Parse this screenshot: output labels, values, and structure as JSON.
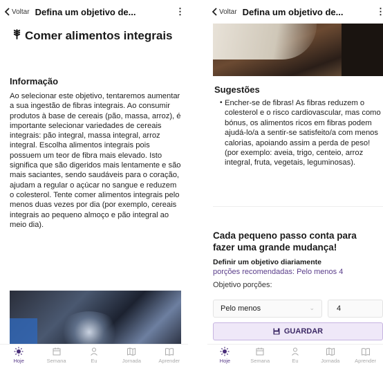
{
  "header": {
    "back_label": "Voltar",
    "title": "Defina um objetivo de...",
    "menu": "⋮"
  },
  "screen1": {
    "goal_title": "Comer alimentos integrais",
    "info_heading": "Informação",
    "info_text": "Ao selecionar este objetivo, tentaremos aumentar a sua ingestão de fibras integrais. Ao consumir produtos à base de cereais (pão, massa, arroz), é importante selecionar variedades de cereais integrais: pão integral, massa integral, arroz integral. Escolha alimentos integrais pois possuem um teor de fibra mais elevado. Isto significa que são digeridos mais lentamente e são mais saciantes, sendo saudáveis para o coração, ajudam a regular o açúcar no sangue e reduzem o colesterol. Tente comer alimentos integrais pelo menos duas vezes por dia (por exemplo, cereais integrais ao pequeno almoço e pão integral ao meio dia)."
  },
  "screen2": {
    "suggestions_heading": "Sugestões",
    "suggestion_text": "Encher-se de fibras! As fibras reduzem o colesterol e o risco cardiovascular, mas como bónus, os alimentos ricos em fibras podem ajudá-lo/a a sentir-se satisfeito/a com menos calorias, apoiando assim a perda de peso! (por exemplo: aveia, trigo, centeio, arroz integral, fruta, vegetais, leguminosas).",
    "cta": "Cada pequeno passo conta para fazer uma grande mudança!",
    "daily_goal_label": "Definir um objetivo diariamente",
    "recommended": "porções recomendadas: Pelo menos 4",
    "goal_portions_label": "Objetivo porções:",
    "select_value": "Pelo menos",
    "number_value": "4",
    "save_label": "GUARDAR"
  },
  "nav": {
    "items": [
      {
        "label": "Hoje",
        "icon": "sun-icon"
      },
      {
        "label": "Semana",
        "icon": "calendar-icon"
      },
      {
        "label": "Eu",
        "icon": "person-icon"
      },
      {
        "label": "Jornada",
        "icon": "map-icon"
      },
      {
        "label": "Aprender",
        "icon": "book-icon"
      }
    ]
  },
  "colors": {
    "accent": "#5a3d8a",
    "active_icon": "#4a2f7a",
    "button_bg": "#efe8f8"
  }
}
